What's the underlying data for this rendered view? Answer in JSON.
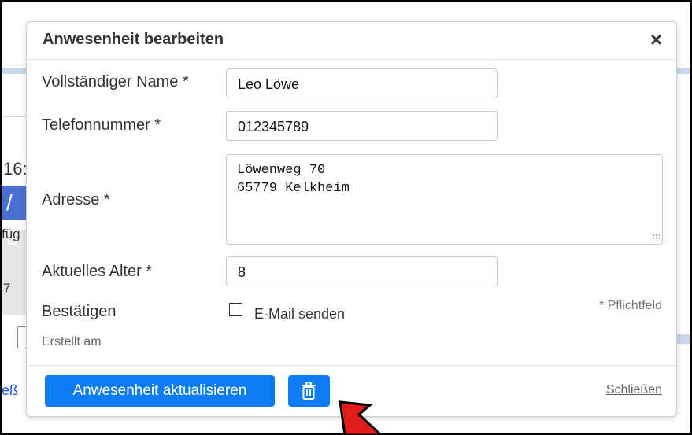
{
  "background": {
    "frag_1": "16:",
    "frag_2": "/ 8",
    "frag_3": "füg",
    "frag_4": "7",
    "frag_5": "eß"
  },
  "modal": {
    "title": "Anwesenheit bearbeiten",
    "close_symbol": "×",
    "fields": {
      "name_label": "Vollständiger Name *",
      "name_value": "Leo Löwe",
      "phone_label": "Telefonnummer *",
      "phone_value": "012345789",
      "address_label": "Adresse *",
      "address_line1": "Löwenweg 70",
      "address_line2": "65779 Kelkheim",
      "age_label": "Aktuelles Alter *",
      "age_value": "8",
      "confirm_label": "Bestätigen",
      "email_checkbox_label": "E-Mail senden",
      "email_checked": false,
      "required_note": "* Pflichtfeld",
      "created_label": "Erstellt am"
    },
    "footer": {
      "update_button": "Anwesenheit aktualisieren",
      "delete_icon": "trash-icon",
      "close_link": "Schließen"
    }
  },
  "colors": {
    "primary": "#0d7cf2",
    "arrow": "#e21b1b"
  }
}
